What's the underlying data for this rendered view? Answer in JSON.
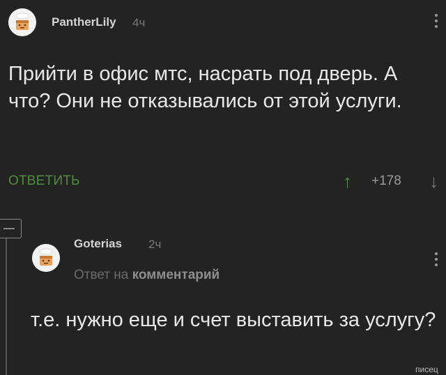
{
  "comment": {
    "author": "PantherLily",
    "time": "4ч",
    "text": "Прийти в офис мтс, насрать под дверь. А что? Они не отказывались от этой услуги.",
    "reply_label": "ОТВЕТИТЬ",
    "rating": "+178"
  },
  "reply": {
    "author": "Goterias",
    "time": "2ч",
    "reply_prefix": "Ответ на",
    "reply_target": "комментарий",
    "text": "т.е. нужно еще и счет выставить за услугу?"
  },
  "watermark": "писец",
  "icons": {
    "avatar": "cake-avatar-icon",
    "more": "more-vertical-icon",
    "upvote": "arrow-up-icon",
    "downvote": "arrow-down-icon",
    "collapse": "collapse-thread-icon"
  },
  "colors": {
    "background": "#232323",
    "accent_green": "#4f8f3c",
    "muted": "#7a7a7a",
    "text": "#e8e8e8"
  }
}
